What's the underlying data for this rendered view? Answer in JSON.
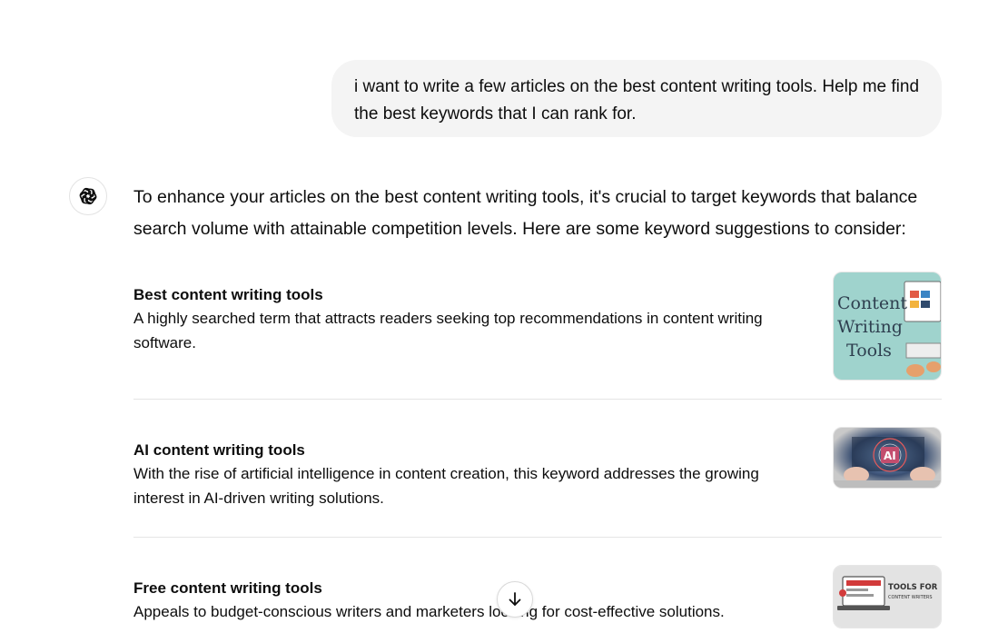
{
  "user_message": "i want to write a few articles on the best content writing tools. Help me find the best keywords that I can rank for.",
  "assistant": {
    "avatar_icon": "openai-logo-icon",
    "intro": "To enhance your articles on the best content writing tools, it's crucial to target keywords that balance search volume with attainable competition levels. Here are some keyword suggestions to consider:",
    "items": [
      {
        "title": "Best content writing tools",
        "description": "A highly searched term that attracts readers seeking top recommendations in content writing software.",
        "thumb_text": [
          "Content",
          "Writing",
          "Tools"
        ]
      },
      {
        "title": "AI content writing tools",
        "description": "With the rise of artificial intelligence in content creation, this keyword addresses the growing interest in AI-driven writing solutions.",
        "thumb_text": [
          "AI"
        ]
      },
      {
        "title": "Free content writing tools",
        "description": "Appeals to budget-conscious writers and marketers looking for cost-effective solutions.",
        "thumb_text": [
          "TOOLS FOR",
          "CONTENT WRITERS"
        ]
      }
    ]
  },
  "scroll_button_icon": "arrow-down-icon"
}
